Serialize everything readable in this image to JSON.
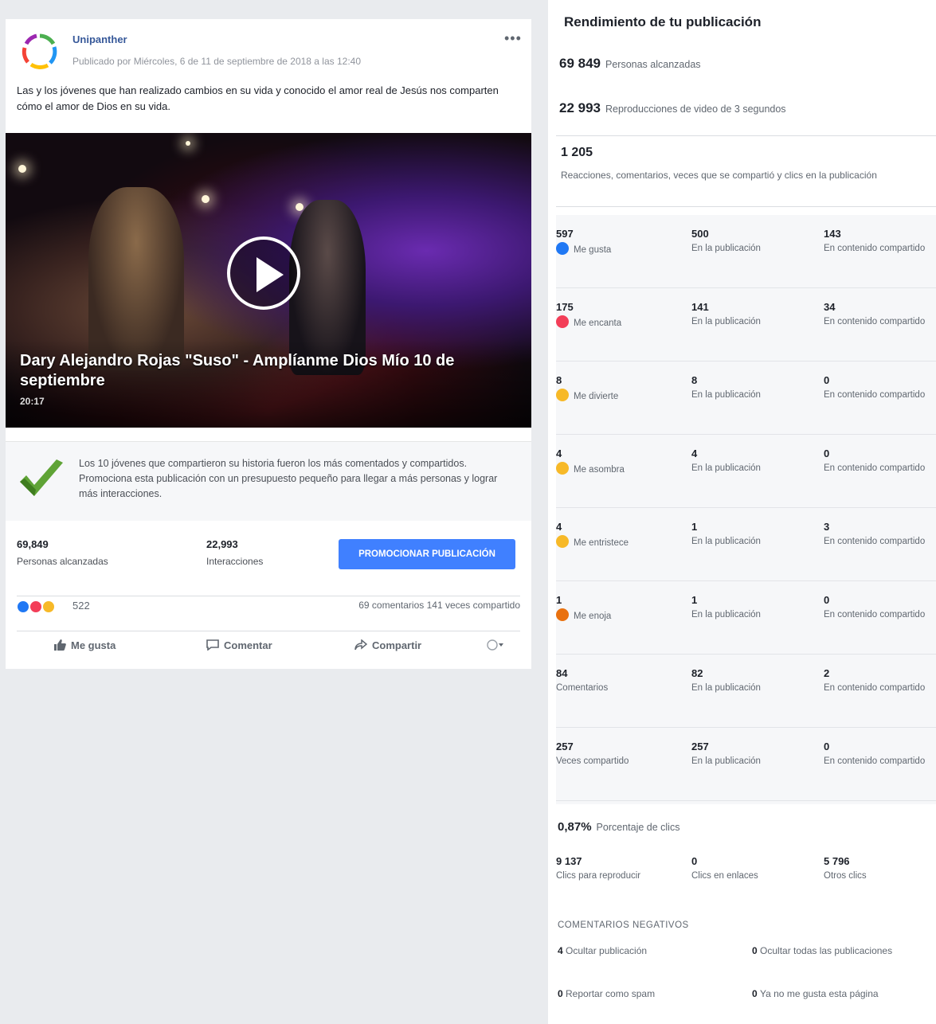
{
  "post": {
    "page_name": "Unipanther",
    "meta": "Publicado por Miércoles, 6 de 11 de septiembre de 2018 a las 12:40",
    "text": "Las y los jóvenes que han realizado cambios en su vida y conocido el amor real de Jesús nos comparten cómo el amor de Dios en su vida.",
    "more_label": "•••",
    "video": {
      "title": "Dary Alejandro Rojas \"Suso\" - Amplíanme Dios Mío 10 de septiembre",
      "subtitle": "20:17"
    },
    "notice": "Los 10 jóvenes que compartieron su historia fueron los más comentados y compartidos. Promociona esta publicación con un presupuesto pequeño para llegar a más personas y lograr más interacciones.",
    "stats": {
      "reach_value": "69,849",
      "reach_label": "Personas alcanzadas",
      "engagement_value": "22,993",
      "engagement_label": "Interacciones",
      "boost_label": "PROMOCIONAR PUBLICACIÓN"
    },
    "reactions": {
      "count": "522",
      "right_text": "69 comentarios  141 veces compartido"
    },
    "actions": {
      "like": "Me gusta",
      "comment": "Comentar",
      "share": "Compartir"
    },
    "colors": {
      "link": "#365899",
      "boost": "#4080ff",
      "like_blue": "#2078f4",
      "love_red": "#f33e58",
      "haha_yellow": "#f7b928",
      "angry_orange": "#e9710f"
    }
  },
  "panel": {
    "title": "Rendimiento de tu publicación",
    "reach_value": "69 849",
    "reach_label": "Personas alcanzadas",
    "views_value": "22 993",
    "views_label": "Reproducciones de video de 3 segundos",
    "clicks_value": "1 205",
    "clicks_label": "Reacciones, comentarios, veces que se compartió y clics en la publicación",
    "rows": [
      {
        "icon": "like-icon",
        "total": "597",
        "total_label": "Me gusta",
        "post": "500",
        "post_label": "En la publicación",
        "shared": "143",
        "shared_label": "En contenido compartido"
      },
      {
        "icon": "love-icon",
        "total": "175",
        "total_label": "Me encanta",
        "post": "141",
        "post_label": "En la publicación",
        "shared": "34",
        "shared_label": "En contenido compartido"
      },
      {
        "icon": "haha-icon",
        "total": "8",
        "total_label": "Me divierte",
        "post": "8",
        "post_label": "En la publicación",
        "shared": "0",
        "shared_label": "En contenido compartido"
      },
      {
        "icon": "wow-icon",
        "total": "4",
        "total_label": "Me asombra",
        "post": "4",
        "post_label": "En la publicación",
        "shared": "0",
        "shared_label": "En contenido compartido"
      },
      {
        "icon": "sad-icon",
        "total": "4",
        "total_label": "Me entristece",
        "post": "1",
        "post_label": "En la publicación",
        "shared": "3",
        "shared_label": "En contenido compartido"
      },
      {
        "icon": "angry-icon",
        "total": "1",
        "total_label": "Me enoja",
        "post": "1",
        "post_label": "En la publicación",
        "shared": "0",
        "shared_label": "En contenido compartido"
      },
      {
        "icon": "",
        "total": "84",
        "total_label": "Comentarios",
        "post": "82",
        "post_label": "En la publicación",
        "shared": "2",
        "shared_label": "En contenido compartido"
      },
      {
        "icon": "",
        "total": "257",
        "total_label": "Veces compartido",
        "post": "257",
        "post_label": "En la publicación",
        "shared": "0",
        "shared_label": "En contenido compartido"
      }
    ],
    "ctr_value": "0,87%",
    "ctr_label": "Porcentaje de clics",
    "neg": [
      {
        "value": "9 137",
        "label": "Clics para reproducir"
      },
      {
        "value": "0",
        "label": "Clics en enlaces"
      },
      {
        "value": "5 796",
        "label": "Otros clics"
      }
    ],
    "others_title": "COMENTARIOS NEGATIVOS",
    "others": [
      {
        "value": "4",
        "label": "Ocultar publicación"
      },
      {
        "value": "0",
        "label": "Ocultar todas las publicaciones"
      },
      {
        "value": "0",
        "label": "Reportar como spam"
      },
      {
        "value": "0",
        "label": "Ya no me gusta esta página"
      }
    ]
  }
}
